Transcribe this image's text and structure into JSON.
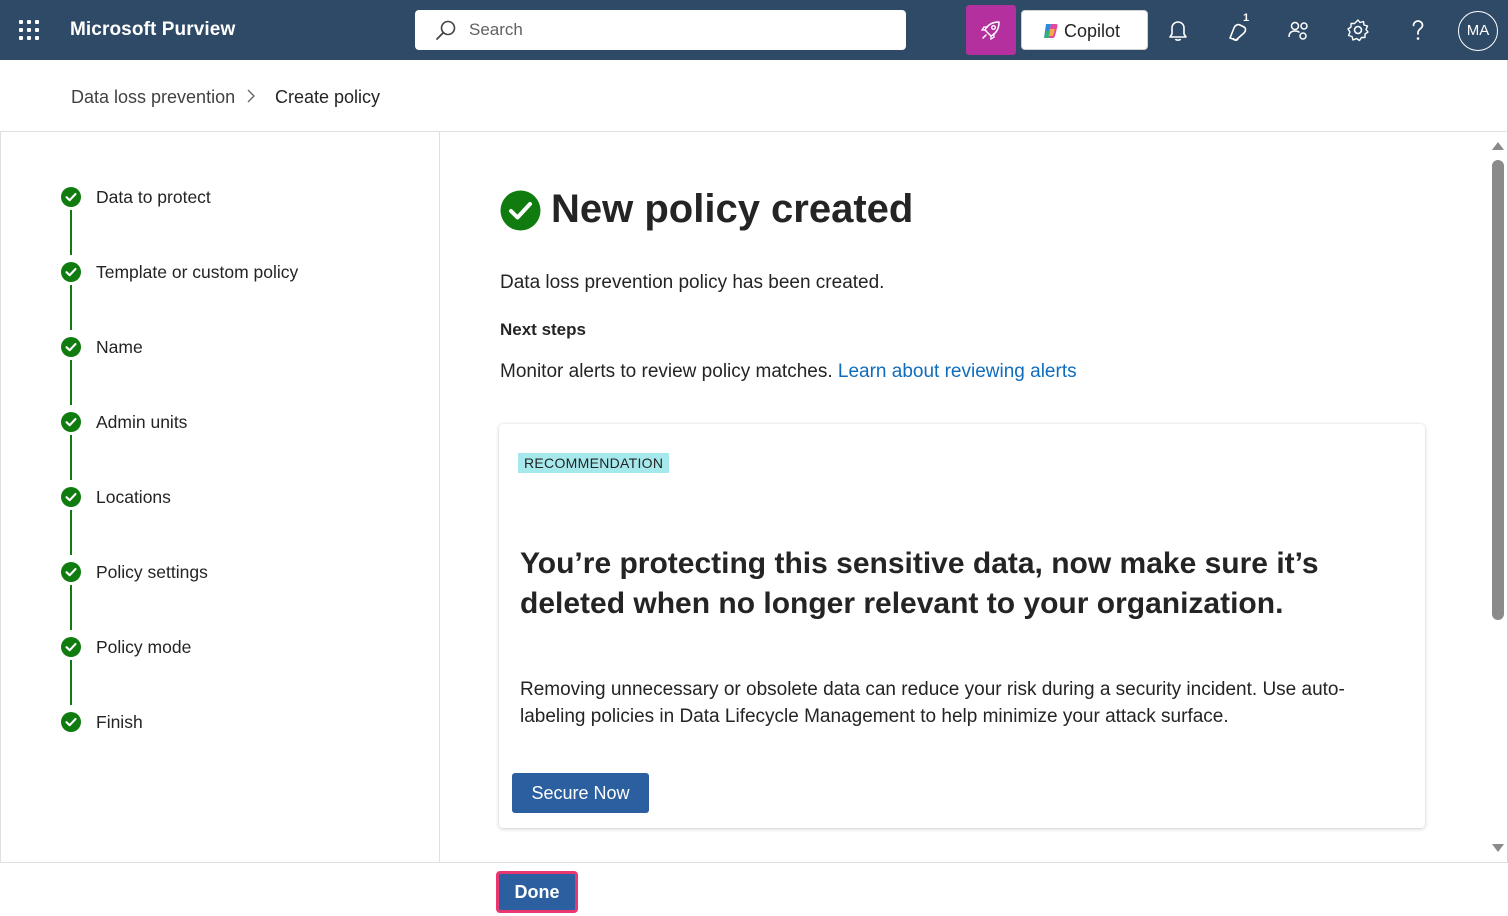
{
  "app": {
    "title": "Microsoft Purview"
  },
  "search": {
    "placeholder": "Search"
  },
  "topbar": {
    "copilot_label": "Copilot",
    "notification_count": "1",
    "avatar_initials": "MA"
  },
  "breadcrumb": {
    "parent": "Data loss prevention",
    "current": "Create policy"
  },
  "steps": [
    {
      "label": "Data to protect",
      "status": "complete"
    },
    {
      "label": "Template or custom policy",
      "status": "complete"
    },
    {
      "label": "Name",
      "status": "complete"
    },
    {
      "label": "Admin units",
      "status": "complete"
    },
    {
      "label": "Locations",
      "status": "complete"
    },
    {
      "label": "Policy settings",
      "status": "complete"
    },
    {
      "label": "Policy mode",
      "status": "complete"
    },
    {
      "label": "Finish",
      "status": "complete"
    }
  ],
  "main": {
    "title": "New policy created",
    "description": "Data loss prevention policy has been created.",
    "next_steps_heading": "Next steps",
    "monitor_text": "Monitor alerts to review policy matches.",
    "monitor_link": "Learn about reviewing alerts"
  },
  "card": {
    "tag": "RECOMMENDATION",
    "heading": "You’re protecting this sensitive data, now make sure it’s deleted when no longer relevant to your organization.",
    "body": "Removing unnecessary or obsolete data can reduce your risk during a security incident. Use auto-labeling policies in Data Lifecycle Management to help minimize your attack surface.",
    "button_label": "Secure Now"
  },
  "footer": {
    "done_label": "Done"
  },
  "colors": {
    "topbar": "#2f4a66",
    "accent": "#2b5f9f",
    "success": "#107c10",
    "highlight_border": "#e8386f",
    "rocket": "#b4309e"
  }
}
